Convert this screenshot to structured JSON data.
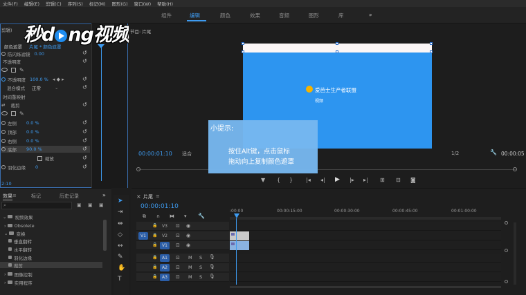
{
  "menu": [
    "文件(F)",
    "编辑(E)",
    "剪辑(C)",
    "序列(S)",
    "标记(M)",
    "图形(G)",
    "窗口(W)",
    "帮助(H)"
  ],
  "workspace_tabs": [
    "组件",
    "编辑",
    "颜色",
    "效果",
    "音频",
    "图形",
    "库"
  ],
  "workspace_active": "编辑",
  "workspace_more": "»",
  "logo_text": {
    "part1": "秒d",
    "part2": "ng视频"
  },
  "effect_controls": {
    "panel_label": "剪辑)",
    "clip_path": "片尾 * 颜色遮罩",
    "header_left": "颜色遮罩",
    "rows": [
      {
        "label": "防闪烁滤镜",
        "value": "0.00"
      },
      {
        "label": "不透明度",
        "value": ""
      },
      {
        "label": "不透明度",
        "value": "100.0 %"
      },
      {
        "label": "混合模式",
        "value": "正常"
      },
      {
        "label": "时间重映射",
        "value": ""
      },
      {
        "label": "裁剪",
        "value": ""
      },
      {
        "label": "左侧",
        "value": "0.0 %"
      },
      {
        "label": "顶部",
        "value": "0.0 %"
      },
      {
        "label": "右侧",
        "value": "0.0 %"
      },
      {
        "label": "底部",
        "value": "90.0 %"
      },
      {
        "label": "缩放",
        "value": ""
      },
      {
        "label": "羽化边缘",
        "value": "0"
      }
    ],
    "footer_time": "2:10"
  },
  "program": {
    "title": "节目: 片尾",
    "timecode": "00:00:01:10",
    "fit": "适合",
    "resolution": "1/2",
    "end_timecode": "00:00:05",
    "frame_text": "爱芭士生产者联盟",
    "frame_sub": "视频"
  },
  "tooltip": {
    "title": "小提示:",
    "line1": "按住Alt键，点击鼠标",
    "line2": "拖动向上复制颜色遮罩"
  },
  "effects_panel": {
    "tabs": [
      "效果",
      "标记",
      "历史记录"
    ],
    "more": "»",
    "items": [
      "视频效果",
      "Obsolete",
      "变换",
      "垂直翻转",
      "水平翻转",
      "羽化边缘",
      "裁剪",
      "图像控制",
      "实用程序"
    ]
  },
  "timeline": {
    "title": "片尾",
    "timecode": "00:00:01:10",
    "ruler": [
      ":00:00",
      "00:00:15:00",
      "00:00:30:00",
      "00:00:45:00",
      "00:01:00:00"
    ],
    "tracks": [
      {
        "name": "V3",
        "target": ""
      },
      {
        "name": "V2",
        "target": "V1"
      },
      {
        "name": "V1",
        "target": ""
      },
      {
        "name": "A1",
        "target": ""
      },
      {
        "name": "A2",
        "target": ""
      },
      {
        "name": "A3",
        "target": ""
      }
    ],
    "mute": "M",
    "solo": "S"
  },
  "colors": {
    "accent": "#3e9bf0",
    "frame": "#2d95f0",
    "tooltip": "#77b7ef",
    "track_on": "#2b5ea8"
  }
}
